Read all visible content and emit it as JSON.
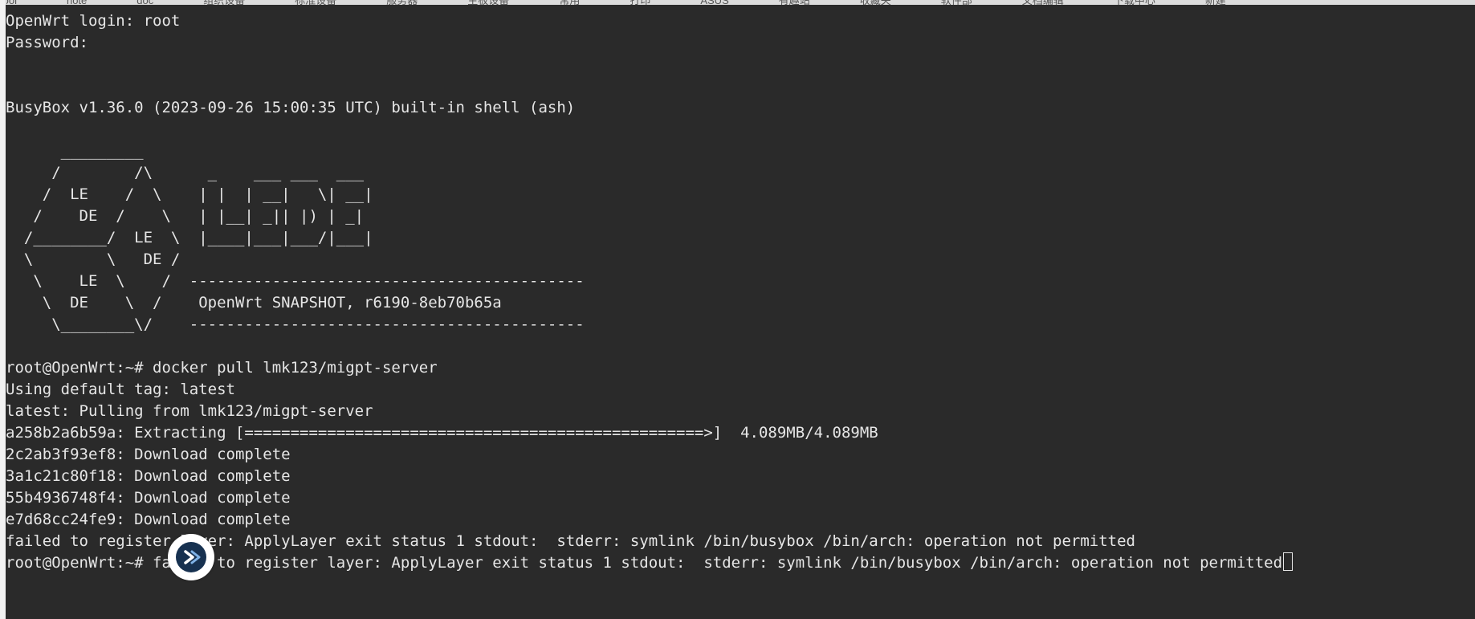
{
  "terminal": {
    "lines": [
      "OpenWrt login: root",
      "Password:",
      "",
      "",
      "BusyBox v1.36.0 (2023-09-26 15:00:35 UTC) built-in shell (ash)",
      "",
      "      _________",
      "     /        /\\      _    ___ ___  ___",
      "    /  LE    /  \\    | |  | __|   \\| __|",
      "   /    DE  /    \\   | |__| _|| |) | _|",
      "  /________/  LE  \\  |____|___|___/|___|",
      "  \\        \\   DE /",
      "   \\    LE  \\    /  -------------------------------------------",
      "    \\  DE    \\  /    OpenWrt SNAPSHOT, r6190-8eb70b65a",
      "     \\________\\/    -------------------------------------------",
      "",
      "root@OpenWrt:~# docker pull lmk123/migpt-server",
      "Using default tag: latest",
      "latest: Pulling from lmk123/migpt-server",
      "a258b2a6b59a: Extracting [==================================================>]  4.089MB/4.089MB",
      "2c2ab3f93ef8: Download complete",
      "3a1c21c80f18: Download complete",
      "55b4936748f4: Download complete",
      "e7d68cc24fe9: Download complete",
      "failed to register layer: ApplyLayer exit status 1 stdout:  stderr: symlink /bin/busybox /bin/arch: operation not permitted",
      "root@OpenWrt:~# failed to register layer: ApplyLayer exit status 1 stdout:  stderr: symlink /bin/busybox /bin/arch: operation not permitted"
    ]
  },
  "background_window": {
    "tabs": [
      "tool",
      "note",
      "doc",
      "组织设备",
      "标准设备",
      "服务器",
      "主板设备",
      "常用",
      "打印",
      "ASUS",
      "有趣站",
      "收藏夹",
      "软件部",
      "文档编辑",
      "下载中心",
      "新建"
    ]
  },
  "floating_icon": {
    "name": "app-shortcut-icon"
  },
  "colors": {
    "terminal_bg": "#2a2a2a",
    "terminal_fg": "#e6e6e6",
    "icon_bg": "#173150"
  }
}
